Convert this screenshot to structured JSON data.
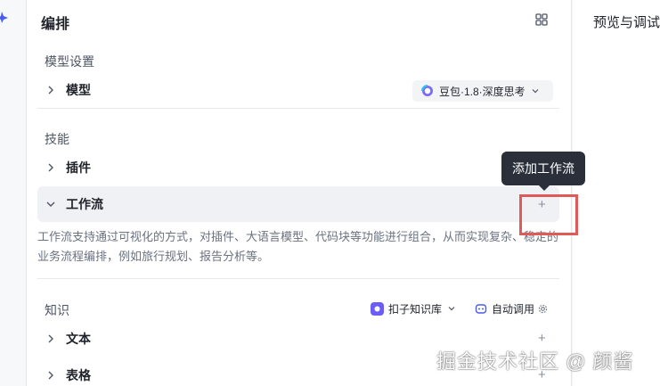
{
  "arrange_panel": {
    "title": "编排"
  },
  "preview_panel": {
    "title": "预览与调试"
  },
  "model_settings": {
    "section_label": "模型设置",
    "row_label": "模型",
    "model_value": "豆包·1.8·深度思考"
  },
  "skills": {
    "section_label": "技能",
    "plugin_label": "插件",
    "workflow_label": "工作流",
    "workflow_description": "工作流支持通过可视化的方式，对插件、大语言模型、代码块等功能进行组合，从而实现复杂、稳定的业务流程编排，例如旅行规划、报告分析等。",
    "add_plus": "+"
  },
  "tooltip": {
    "text": "添加工作流"
  },
  "knowledge": {
    "section_label": "知识",
    "kb_selector": "扣子知识库",
    "auto_call": "自动调用",
    "text_label": "文本",
    "table_label": "表格",
    "add_plus": "+"
  },
  "watermark": {
    "text": "掘金技术社区 @ 颜酱"
  },
  "colors": {
    "highlight": "#e05a5a",
    "tooltip_bg": "#2a2f3a",
    "kb_accent": "#6b5cf6"
  }
}
